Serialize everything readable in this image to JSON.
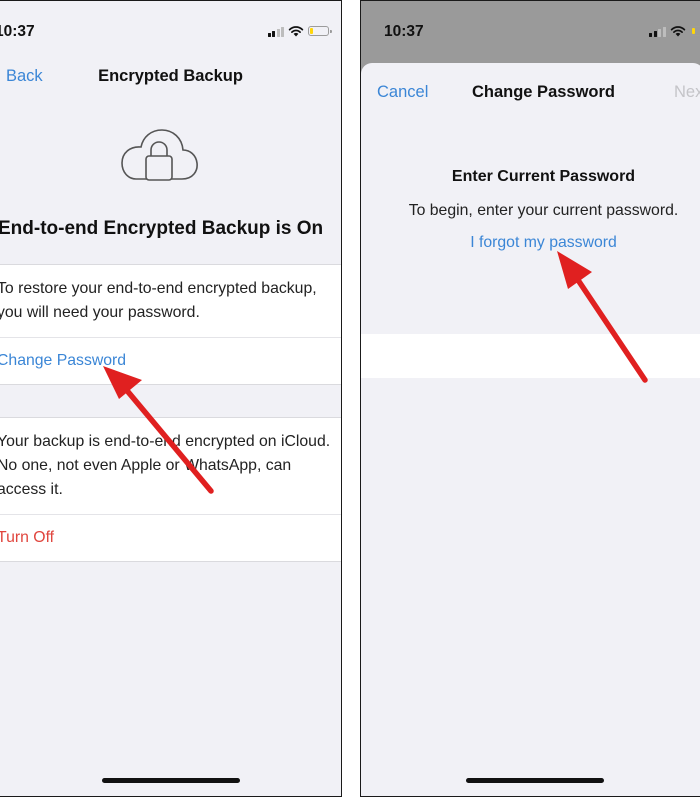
{
  "screen1": {
    "status": {
      "time": "10:37"
    },
    "nav": {
      "back": "Back",
      "title": "Encrypted Backup"
    },
    "hero_title": "End-to-end Encrypted Backup is On",
    "section1": {
      "desc": "To restore your end-to-end encrypted backup, you will need your password.",
      "action": "Change Password"
    },
    "section2": {
      "desc": "Your backup is end-to-end encrypted on iCloud. No one, not even Apple or WhatsApp, can access it.",
      "action": "Turn Off"
    }
  },
  "screen2": {
    "status": {
      "time": "10:37"
    },
    "nav": {
      "cancel": "Cancel",
      "title": "Change Password",
      "next": "Next"
    },
    "heading": "Enter Current Password",
    "subtitle": "To begin, enter your current password.",
    "forgot_link": "I forgot my password",
    "password_field": {
      "value": "",
      "placeholder": ""
    }
  },
  "colors": {
    "link_blue": "#3b86d6",
    "destructive_red": "#e0453d",
    "annotation_arrow": "#e02020",
    "background": "#f1f1f6"
  },
  "icons": [
    "cloud-lock-icon",
    "cellular-signal-icon",
    "wifi-icon",
    "battery-icon"
  ]
}
